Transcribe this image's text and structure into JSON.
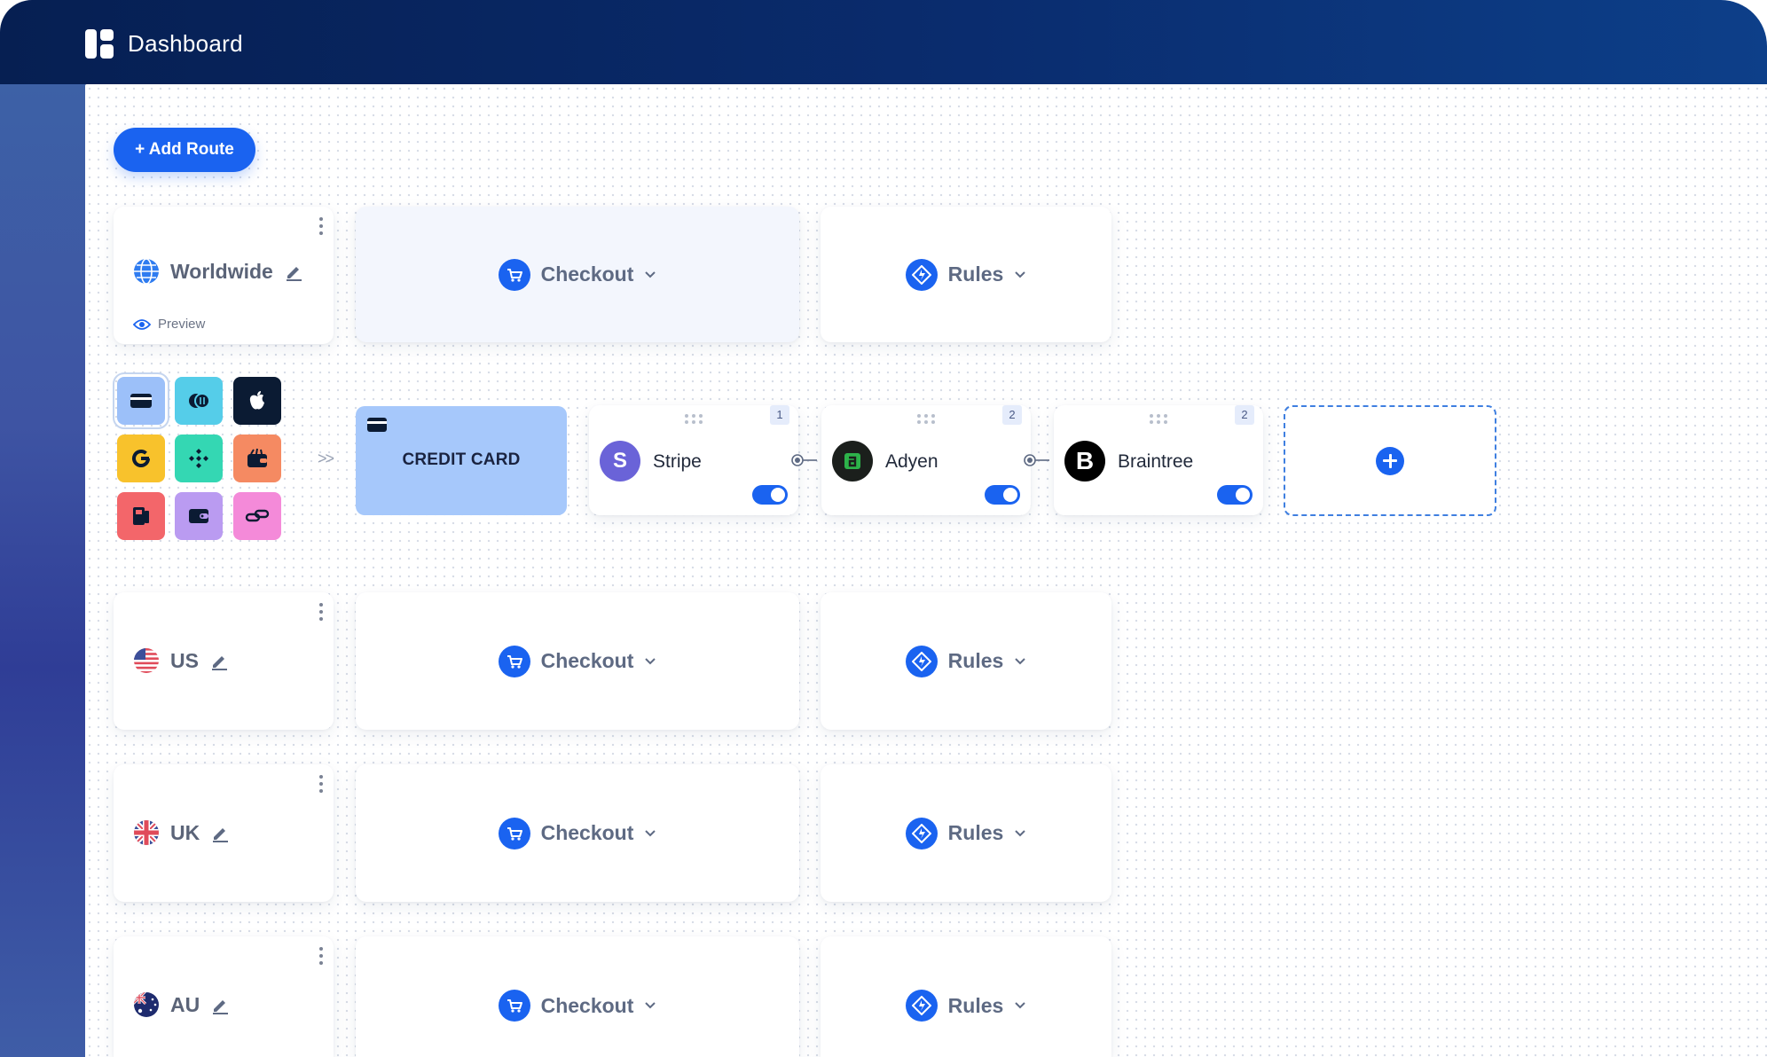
{
  "app": {
    "title": "Dashboard"
  },
  "toolbar": {
    "add_route_label": "+ Add Route"
  },
  "routes": [
    {
      "region": "Worldwide",
      "preview_label": "Preview",
      "checkout_label": "Checkout",
      "rules_label": "Rules"
    },
    {
      "region": "US",
      "checkout_label": "Checkout",
      "rules_label": "Rules"
    },
    {
      "region": "UK",
      "checkout_label": "Checkout",
      "rules_label": "Rules"
    },
    {
      "region": "AU",
      "checkout_label": "Checkout",
      "rules_label": "Rules"
    }
  ],
  "payment_methods": [
    {
      "icon": "credit-card-icon",
      "color": "#9cc0f9",
      "selected": true
    },
    {
      "icon": "coins-icon",
      "color": "#55cde9"
    },
    {
      "icon": "apple-pay-icon",
      "color": "#0b1b33"
    },
    {
      "icon": "google-pay-icon",
      "color": "#f8c22c"
    },
    {
      "icon": "crypto-icon",
      "color": "#34d7b3"
    },
    {
      "icon": "wallet-icon",
      "color": "#f58a62"
    },
    {
      "icon": "terminal-icon",
      "color": "#f3666a"
    },
    {
      "icon": "wallet-card-icon",
      "color": "#ba9bf1"
    },
    {
      "icon": "pay-link-icon",
      "color": "#f48ad9"
    }
  ],
  "selected_method": {
    "label": "CREDIT CARD"
  },
  "processors": [
    {
      "name": "Stripe",
      "priority": "1",
      "enabled": true,
      "color": "#6a63d8",
      "letter": "S"
    },
    {
      "name": "Adyen",
      "priority": "2",
      "enabled": true,
      "color": "#1b1f1c",
      "letter": "a"
    },
    {
      "name": "Braintree",
      "priority": "2",
      "enabled": true,
      "color": "#000000",
      "letter": "B"
    }
  ],
  "colors": {
    "primary": "#1a63f0",
    "header": "#061f52"
  }
}
